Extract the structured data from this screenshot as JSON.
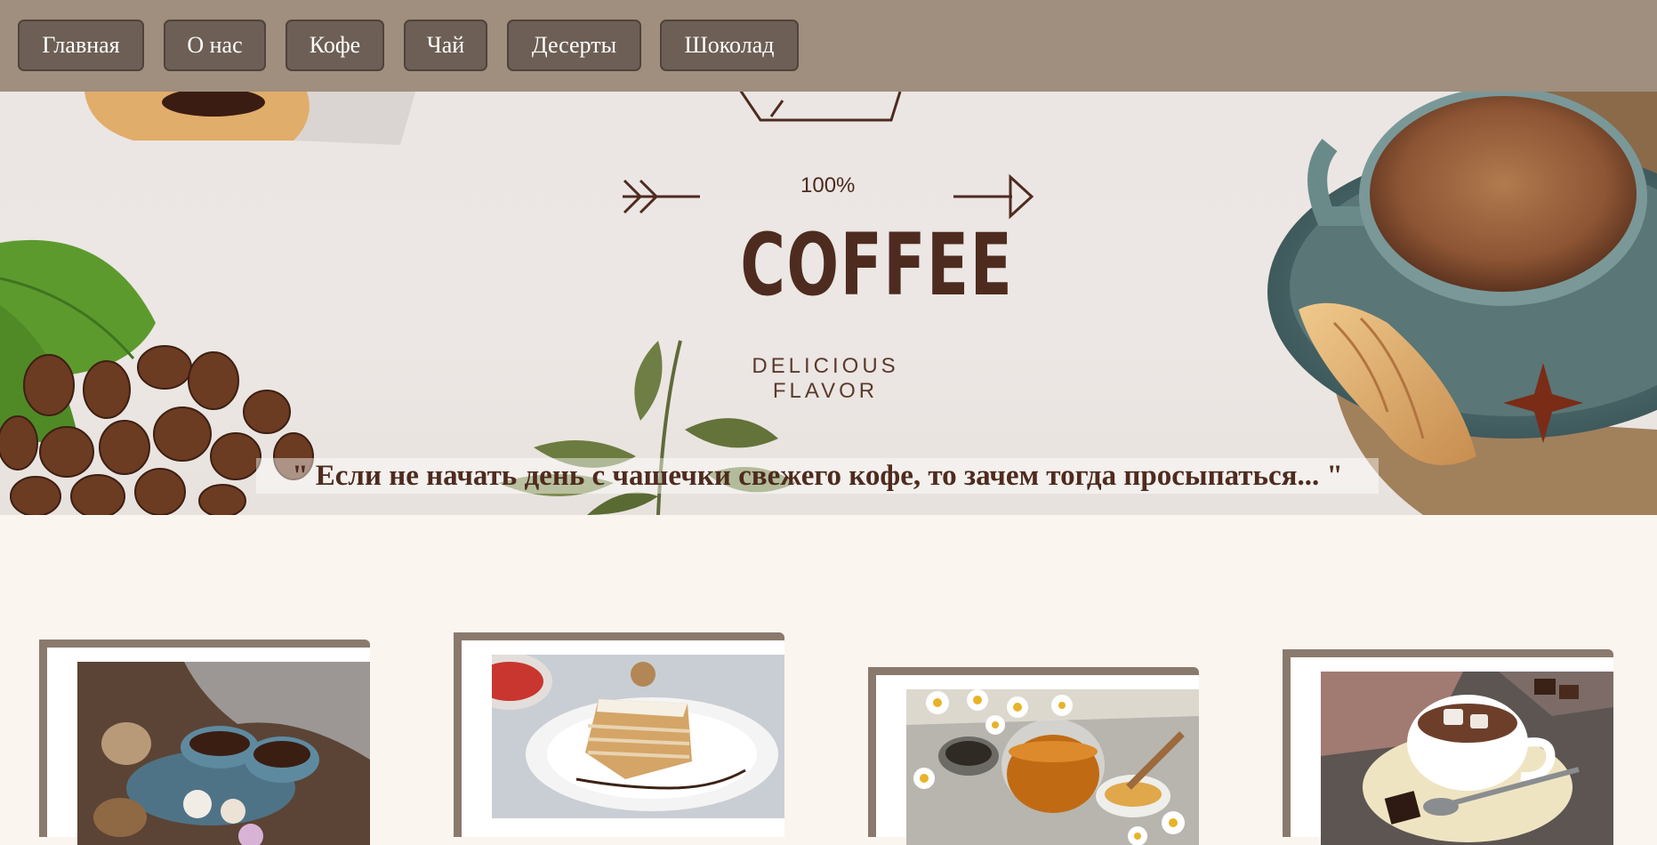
{
  "nav": {
    "items": [
      {
        "label": "Главная"
      },
      {
        "label": "О нас"
      },
      {
        "label": "Кофе"
      },
      {
        "label": "Чай"
      },
      {
        "label": "Десерты"
      },
      {
        "label": "Шоколад"
      }
    ]
  },
  "hero": {
    "badge": "100%",
    "title": "COFFEE",
    "subtitle": "DELICIOUS FLAVOR",
    "quote": "\" Если не начать день с чашечки свежего кофе, то зачем тогда просыпаться... \""
  },
  "cards": [
    {
      "image": "coffee-cups-photo"
    },
    {
      "image": "cake-slice-photo"
    },
    {
      "image": "chamomile-tea-photo"
    },
    {
      "image": "hot-chocolate-photo"
    }
  ],
  "colors": {
    "nav_bg": "#a08e7e",
    "button_bg": "#6d5f55",
    "brand_brown": "#4e2b1f",
    "page_bg": "#faf5ef",
    "card_border": "#8a7a6d"
  }
}
